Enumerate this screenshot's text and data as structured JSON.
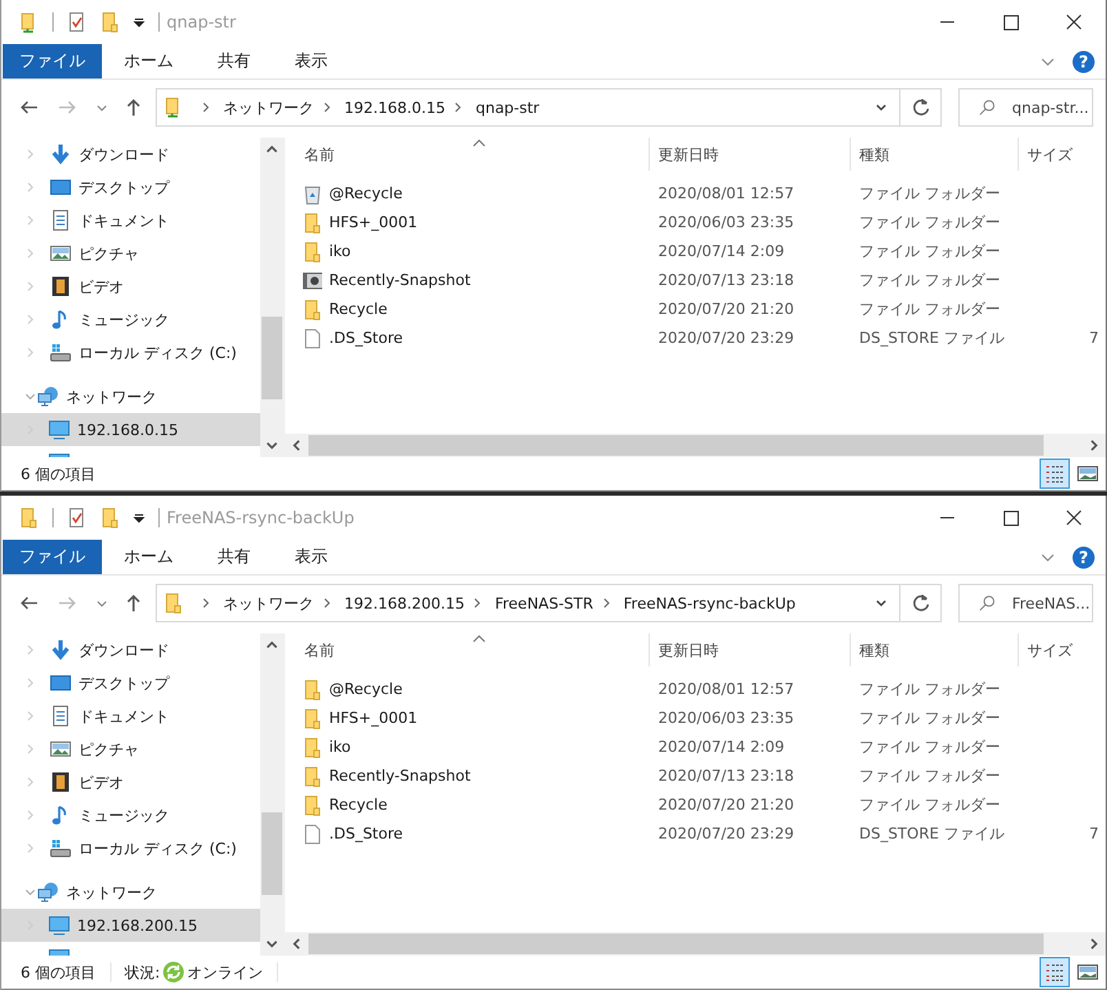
{
  "windows": [
    {
      "title": "qnap-str",
      "title_icon": {
        "kind": "network-folder"
      },
      "ribbon_tabs": [
        {
          "label": "ファイル",
          "selected": true
        },
        {
          "label": "ホーム",
          "selected": false
        },
        {
          "label": "共有",
          "selected": false
        },
        {
          "label": "表示",
          "selected": false
        }
      ],
      "help_label": "?",
      "location_icon": {
        "kind": "network-folder"
      },
      "breadcrumb": [
        "ネットワーク",
        "192.168.0.15",
        "qnap-str"
      ],
      "search": {
        "placeholder": "qnap-str..."
      },
      "nav": [
        {
          "label": "ダウンロード",
          "kind": "download"
        },
        {
          "label": "デスクトップ",
          "kind": "desktop"
        },
        {
          "label": "ドキュメント",
          "kind": "documents"
        },
        {
          "label": "ピクチャ",
          "kind": "pictures"
        },
        {
          "label": "ビデオ",
          "kind": "video"
        },
        {
          "label": "ミュージック",
          "kind": "music"
        },
        {
          "label": "ローカル ディスク (C:)",
          "kind": "drive"
        },
        {
          "label": "ネットワーク",
          "kind": "network",
          "expanded": true,
          "children": [
            {
              "label": "192.168.0.15",
              "kind": "computer",
              "selected": true
            },
            {
              "kind": "computer",
              "selected": false
            }
          ]
        }
      ],
      "columns": [
        {
          "label": "名前",
          "sorted": true
        },
        {
          "label": "更新日時",
          "sorted": false
        },
        {
          "label": "種類",
          "sorted": false
        },
        {
          "label": "サイズ",
          "sorted": false
        }
      ],
      "rows": [
        {
          "kind": "recycle",
          "name": "@Recycle",
          "date": "2020/08/01 12:57",
          "type": "ファイル フォルダー"
        },
        {
          "kind": "folder",
          "name": "HFS+_0001",
          "date": "2020/06/03 23:35",
          "type": "ファイル フォルダー"
        },
        {
          "kind": "folder",
          "name": "iko",
          "date": "2020/07/14 2:09",
          "type": "ファイル フォルダー"
        },
        {
          "kind": "snapshot",
          "name": "Recently-Snapshot",
          "date": "2020/07/13 23:18",
          "type": "ファイル フォルダー"
        },
        {
          "kind": "folder",
          "name": "Recycle",
          "date": "2020/07/20 21:20",
          "type": "ファイル フォルダー"
        },
        {
          "kind": "file",
          "name": ".DS_Store",
          "date": "2020/07/20 23:29",
          "type": "DS_STORE ファイル",
          "size": "7"
        }
      ],
      "status": {
        "count": "6 個の項目"
      },
      "view_buttons": [
        {
          "kind": "details",
          "selected": true
        },
        {
          "kind": "large-icons",
          "selected": false
        }
      ]
    },
    {
      "title": "FreeNAS-rsync-backUp",
      "title_icon": {
        "kind": "folder"
      },
      "ribbon_tabs": [
        {
          "label": "ファイル",
          "selected": true
        },
        {
          "label": "ホーム",
          "selected": false
        },
        {
          "label": "共有",
          "selected": false
        },
        {
          "label": "表示",
          "selected": false
        }
      ],
      "help_label": "?",
      "location_icon": {
        "kind": "folder"
      },
      "breadcrumb": [
        "ネットワーク",
        "192.168.200.15",
        "FreeNAS-STR",
        "FreeNAS-rsync-backUp"
      ],
      "search": {
        "placeholder": "FreeNAS..."
      },
      "nav": [
        {
          "label": "ダウンロード",
          "kind": "download"
        },
        {
          "label": "デスクトップ",
          "kind": "desktop"
        },
        {
          "label": "ドキュメント",
          "kind": "documents"
        },
        {
          "label": "ピクチャ",
          "kind": "pictures"
        },
        {
          "label": "ビデオ",
          "kind": "video"
        },
        {
          "label": "ミュージック",
          "kind": "music"
        },
        {
          "label": "ローカル ディスク (C:)",
          "kind": "drive"
        },
        {
          "label": "ネットワーク",
          "kind": "network",
          "expanded": true,
          "children": [
            {
              "label": "192.168.200.15",
              "kind": "computer",
              "selected": true
            },
            {
              "kind": "computer",
              "selected": false
            }
          ]
        }
      ],
      "columns": [
        {
          "label": "名前",
          "sorted": true
        },
        {
          "label": "更新日時",
          "sorted": false
        },
        {
          "label": "種類",
          "sorted": false
        },
        {
          "label": "サイズ",
          "sorted": false
        }
      ],
      "rows": [
        {
          "kind": "folder",
          "name": "@Recycle",
          "date": "2020/08/01 12:57",
          "type": "ファイル フォルダー"
        },
        {
          "kind": "folder",
          "name": "HFS+_0001",
          "date": "2020/06/03 23:35",
          "type": "ファイル フォルダー"
        },
        {
          "kind": "folder",
          "name": "iko",
          "date": "2020/07/14 2:09",
          "type": "ファイル フォルダー"
        },
        {
          "kind": "folder",
          "name": "Recently-Snapshot",
          "date": "2020/07/13 23:18",
          "type": "ファイル フォルダー"
        },
        {
          "kind": "folder",
          "name": "Recycle",
          "date": "2020/07/20 21:20",
          "type": "ファイル フォルダー"
        },
        {
          "kind": "file",
          "name": ".DS_Store",
          "date": "2020/07/20 23:29",
          "type": "DS_STORE ファイル",
          "size": "7"
        }
      ],
      "status": {
        "count": "6 個の項目",
        "state_label": "状況:",
        "state_value": "オンライン"
      },
      "view_buttons": [
        {
          "kind": "details",
          "selected": true
        },
        {
          "kind": "large-icons",
          "selected": false
        }
      ]
    }
  ]
}
